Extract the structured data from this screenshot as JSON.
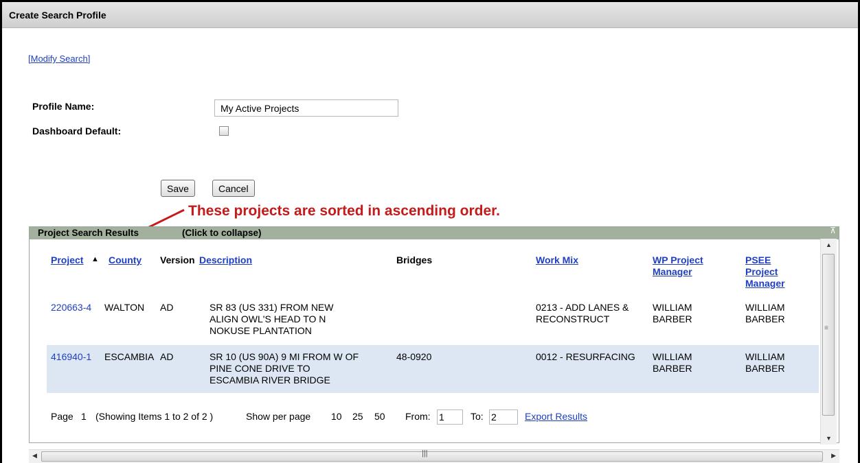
{
  "window": {
    "title": "Create Search Profile"
  },
  "form": {
    "modify_search_link": "[Modify Search]",
    "profile_name_label": "Profile Name:",
    "profile_name_value": "My Active Projects",
    "dashboard_default_label": "Dashboard Default:",
    "dashboard_default_checked": false,
    "save_label": "Save",
    "cancel_label": "Cancel"
  },
  "annotation": {
    "text": "These projects are sorted in ascending order.",
    "color": "#c41a1a"
  },
  "results": {
    "header_title": "Project Search Results",
    "header_collapse": "(Click to collapse)",
    "columns": {
      "project": "Project",
      "sort_indicator": "▲",
      "county": "County",
      "version": "Version",
      "description": "Description",
      "bridges": "Bridges",
      "work_mix": "Work Mix",
      "wp_pm_1": "WP Project",
      "wp_pm_2": "Manager",
      "psee_pm_1": "PSEE",
      "psee_pm_2": "Project",
      "psee_pm_3": "Manager"
    },
    "rows": [
      {
        "project": "220663-4",
        "county": "WALTON",
        "version": "AD",
        "desc1": "SR 83 (US 331) FROM NEW",
        "desc2": "ALIGN OWL'S HEAD TO N",
        "desc3": "NOKUSE PLANTATION",
        "bridges": "",
        "work1": "0213 - ADD LANES &",
        "work2": "RECONSTRUCT",
        "wp1": "WILLIAM",
        "wp2": "BARBER",
        "psee1": "WILLIAM",
        "psee2": "BARBER"
      },
      {
        "project": "416940-1",
        "county": "ESCAMBIA",
        "version": "AD",
        "desc1": "SR 10 (US 90A) 9 MI FROM W OF",
        "desc2": "PINE CONE DRIVE TO",
        "desc3": "ESCAMBIA RIVER BRIDGE",
        "bridges": "48-0920",
        "work1": "0012 - RESURFACING",
        "work2": "",
        "wp1": "WILLIAM",
        "wp2": "BARBER",
        "psee1": "WILLIAM",
        "psee2": "BARBER"
      }
    ],
    "pager": {
      "page_label": "Page",
      "page_num": "1",
      "showing": "(Showing Items 1 to 2 of 2 )",
      "show_per_page": "Show per page",
      "opt10": "10",
      "opt25": "25",
      "opt50": "50",
      "from_label": "From:",
      "from_value": "1",
      "to_label": "To:",
      "to_value": "2",
      "export": "Export Results"
    }
  },
  "icons": {
    "pin": "pin-icon",
    "sort": "sort-ascending-icon"
  }
}
